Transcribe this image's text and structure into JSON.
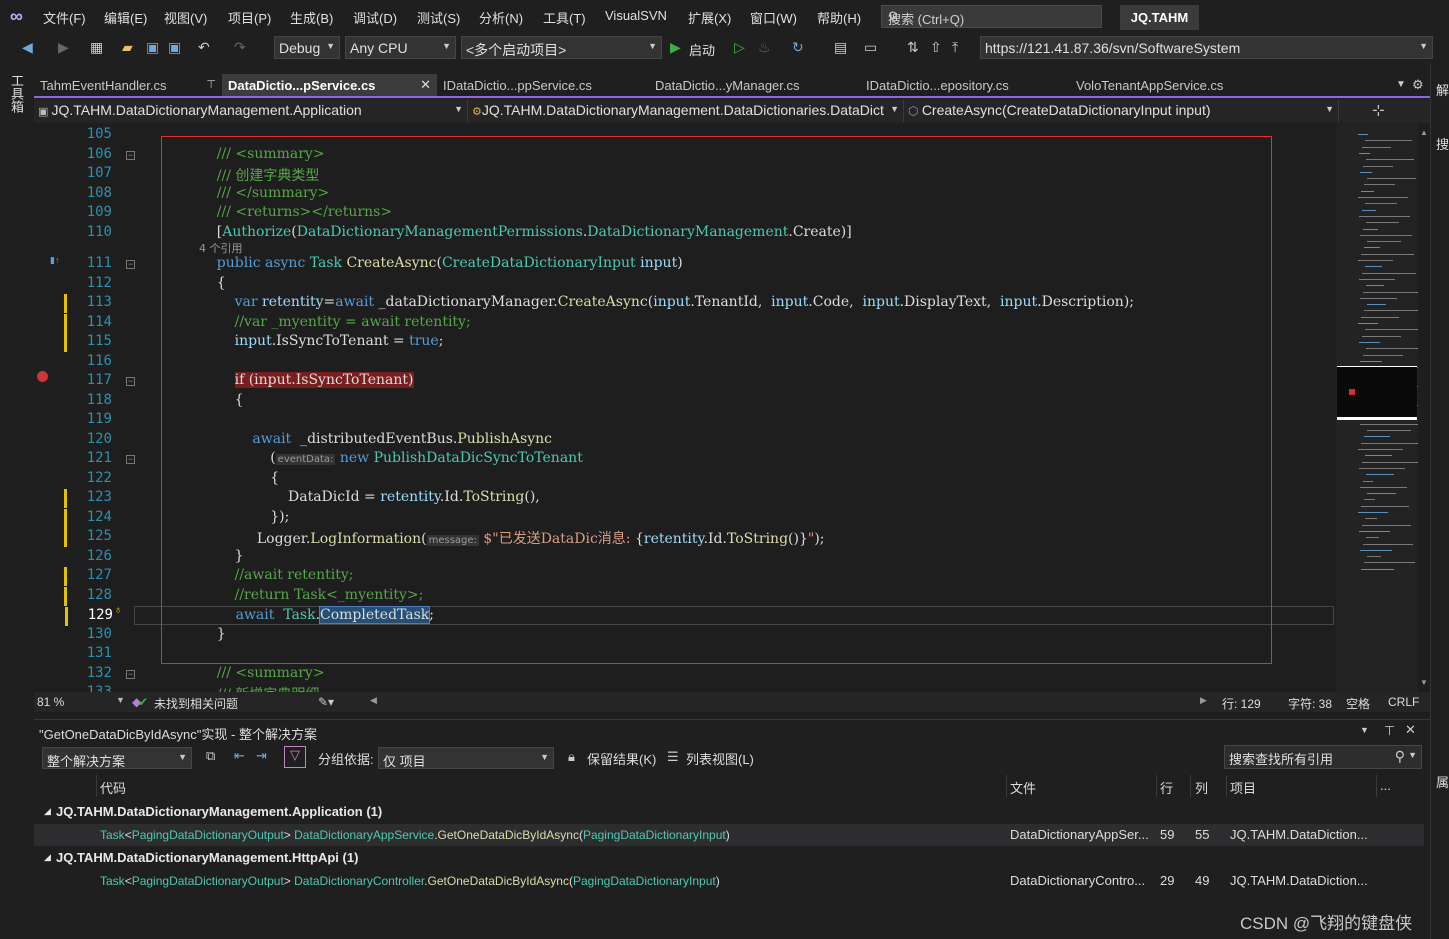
{
  "menu": {
    "items": [
      "文件(F)",
      "编辑(E)",
      "视图(V)",
      "项目(P)",
      "生成(B)",
      "调试(D)",
      "测试(S)",
      "分析(N)",
      "工具(T)",
      "VisualSVN",
      "扩展(X)",
      "窗口(W)",
      "帮助(H)"
    ],
    "search_placeholder": "搜索 (Ctrl+Q)",
    "profile": "JQ.TAHM"
  },
  "toolbar": {
    "config": "Debug",
    "platform": "Any CPU",
    "startup": "<多个启动项目>",
    "start_label": "启动",
    "svn_url": "https://121.41.87.36/svn/SoftwareSystem"
  },
  "left_strip": {
    "toolbox": "工具箱"
  },
  "right_strip": {
    "labels": [
      "解",
      "搜",
      "属"
    ]
  },
  "tabs": [
    {
      "label": "TahmEventHandler.cs",
      "active": false
    },
    {
      "label": "DataDictio...pService.cs",
      "active": true
    },
    {
      "label": "IDataDictio...ppService.cs",
      "active": false
    },
    {
      "label": "DataDictio...yManager.cs",
      "active": false
    },
    {
      "label": "IDataDictio...epository.cs",
      "active": false
    },
    {
      "label": "VoloTenantAppService.cs",
      "active": false
    }
  ],
  "navbar": {
    "project": "JQ.TAHM.DataDictionaryManagement.Application",
    "class": "JQ.TAHM.DataDictionaryManagement.DataDictionaries.DataDict",
    "member": "CreateAsync(CreateDataDictionaryInput input)"
  },
  "code": {
    "lines": [
      {
        "n": "105",
        "segs": []
      },
      {
        "n": "106",
        "segs": [
          {
            "c": "c-com",
            "t": "    /// <summary>"
          }
        ]
      },
      {
        "n": "107",
        "segs": [
          {
            "c": "c-com",
            "t": "    /// 创建字典类型"
          }
        ]
      },
      {
        "n": "108",
        "segs": [
          {
            "c": "c-com",
            "t": "    /// </summary>"
          }
        ]
      },
      {
        "n": "109",
        "segs": [
          {
            "c": "c-com",
            "t": "    /// <returns></returns>"
          }
        ]
      },
      {
        "n": "110",
        "segs": [
          {
            "c": "",
            "t": "    ["
          },
          {
            "c": "c-type",
            "t": "Authorize"
          },
          {
            "c": "",
            "t": "("
          },
          {
            "c": "c-type",
            "t": "DataDictionaryManagementPermissions"
          },
          {
            "c": "",
            "t": "."
          },
          {
            "c": "c-type",
            "t": "DataDictionaryManagement"
          },
          {
            "c": "",
            "t": ".Create)]"
          }
        ]
      },
      {
        "n": "111",
        "segs": [
          {
            "c": "c-kw",
            "t": "    public async "
          },
          {
            "c": "c-type",
            "t": "Task "
          },
          {
            "c": "c-meth",
            "t": "CreateAsync"
          },
          {
            "c": "",
            "t": "("
          },
          {
            "c": "c-type",
            "t": "CreateDataDictionaryInput "
          },
          {
            "c": "c-param",
            "t": "input"
          },
          {
            "c": "",
            "t": ")"
          }
        ]
      },
      {
        "n": "112",
        "segs": [
          {
            "c": "",
            "t": "    {"
          }
        ]
      },
      {
        "n": "113",
        "segs": [
          {
            "c": "c-kw",
            "t": "        var "
          },
          {
            "c": "c-param",
            "t": "retentity"
          },
          {
            "c": "",
            "t": "="
          },
          {
            "c": "c-kw",
            "t": "await "
          },
          {
            "c": "",
            "t": "_dataDictionaryManager."
          },
          {
            "c": "c-meth",
            "t": "CreateAsync"
          },
          {
            "c": "",
            "t": "("
          },
          {
            "c": "c-param",
            "t": "input"
          },
          {
            "c": "",
            "t": ".TenantId,  "
          },
          {
            "c": "c-param",
            "t": "input"
          },
          {
            "c": "",
            "t": ".Code,  "
          },
          {
            "c": "c-param",
            "t": "input"
          },
          {
            "c": "",
            "t": ".DisplayText,  "
          },
          {
            "c": "c-param",
            "t": "input"
          },
          {
            "c": "",
            "t": ".Description);"
          }
        ]
      },
      {
        "n": "114",
        "segs": [
          {
            "c": "c-com",
            "t": "        //var _myentity = await retentity;"
          }
        ]
      },
      {
        "n": "115",
        "segs": [
          {
            "c": "c-param",
            "t": "        input"
          },
          {
            "c": "",
            "t": ".IsSyncToTenant = "
          },
          {
            "c": "c-kw",
            "t": "true"
          },
          {
            "c": "",
            "t": ";"
          }
        ]
      },
      {
        "n": "116",
        "segs": []
      },
      {
        "n": "117",
        "segs": [
          {
            "c": "",
            "t": "        "
          },
          {
            "c": "bp-highlight",
            "t": "if (input.IsSyncToTenant)"
          }
        ]
      },
      {
        "n": "118",
        "segs": [
          {
            "c": "",
            "t": "        {"
          }
        ]
      },
      {
        "n": "119",
        "segs": []
      },
      {
        "n": "120",
        "segs": [
          {
            "c": "c-kw",
            "t": "            await  "
          },
          {
            "c": "",
            "t": "_distributedEventBus."
          },
          {
            "c": "c-meth",
            "t": "PublishAsync"
          }
        ]
      },
      {
        "n": "121",
        "segs": [
          {
            "c": "",
            "t": "                ("
          },
          {
            "c": "c-hint",
            "t": "eventData:"
          },
          {
            "c": "c-kw",
            "t": " new "
          },
          {
            "c": "c-type",
            "t": "PublishDataDicSyncToTenant"
          }
        ]
      },
      {
        "n": "122",
        "segs": [
          {
            "c": "",
            "t": "                {"
          }
        ]
      },
      {
        "n": "123",
        "segs": [
          {
            "c": "",
            "t": "                    DataDicId = "
          },
          {
            "c": "c-param",
            "t": "retentity"
          },
          {
            "c": "",
            "t": ".Id."
          },
          {
            "c": "c-meth",
            "t": "ToString"
          },
          {
            "c": "",
            "t": "(),"
          }
        ]
      },
      {
        "n": "124",
        "segs": [
          {
            "c": "",
            "t": "                });"
          }
        ]
      },
      {
        "n": "125",
        "segs": [
          {
            "c": "",
            "t": "             Logger."
          },
          {
            "c": "c-meth",
            "t": "LogInformation"
          },
          {
            "c": "",
            "t": "("
          },
          {
            "c": "c-hint",
            "t": "message:"
          },
          {
            "c": "c-str",
            "t": " $\"已发送DataDic消息: "
          },
          {
            "c": "",
            "t": "{"
          },
          {
            "c": "c-param",
            "t": "retentity"
          },
          {
            "c": "",
            "t": ".Id."
          },
          {
            "c": "c-meth",
            "t": "ToString"
          },
          {
            "c": "",
            "t": "()}"
          },
          {
            "c": "c-str",
            "t": "\""
          },
          {
            "c": "",
            "t": ");"
          }
        ]
      },
      {
        "n": "126",
        "segs": [
          {
            "c": "",
            "t": "        }"
          }
        ]
      },
      {
        "n": "127",
        "segs": [
          {
            "c": "c-com",
            "t": "        //await retentity;"
          }
        ]
      },
      {
        "n": "128",
        "segs": [
          {
            "c": "c-com",
            "t": "        //return Task<_myentity>;"
          }
        ]
      },
      {
        "n": "129",
        "segs": [
          {
            "c": "c-kw",
            "t": "        await  "
          },
          {
            "c": "c-type",
            "t": "Task"
          },
          {
            "c": "",
            "t": "."
          },
          {
            "c": "sel-word",
            "t": "CompletedTask"
          },
          {
            "c": "",
            "t": ";"
          }
        ]
      },
      {
        "n": "130",
        "segs": [
          {
            "c": "",
            "t": "    }"
          }
        ]
      },
      {
        "n": "131",
        "segs": []
      },
      {
        "n": "132",
        "segs": [
          {
            "c": "c-com",
            "t": "    /// <summary>"
          }
        ]
      },
      {
        "n": "133",
        "segs": [
          {
            "c": "c-com",
            "t": "    /// 新增字典明细"
          }
        ]
      }
    ],
    "ref_count": "4 个引用"
  },
  "editor_status": {
    "zoom": "81 %",
    "issues": "未找到相关问题",
    "line": "行: 129",
    "col": "字符: 38",
    "spaces": "空格",
    "eol": "CRLF"
  },
  "panel": {
    "title": "\"GetOneDataDicByIdAsync\"实现 - 整个解决方案",
    "scope": "整个解决方案",
    "group_by_label": "分组依据:",
    "group_by": "仅 项目",
    "keep_results": "保留结果(K)",
    "list_view": "列表视图(L)",
    "search_placeholder": "搜索查找所有引用",
    "headers": {
      "code": "代码",
      "file": "文件",
      "line": "行",
      "col": "列",
      "project": "项目",
      "more": "..."
    },
    "groups": [
      {
        "name": "JQ.TAHM.DataDictionaryManagement.Application (1)",
        "rows": [
          {
            "sig_type": "Task",
            "sig_ret": "PagingDataDictionaryOutput",
            "sig_class": "DataDictionaryAppService",
            "sig_method": "GetOneDataDicByIdAsync",
            "sig_param": "PagingDataDictionaryInput",
            "file": "DataDictionaryAppSer...",
            "line": "59",
            "col": "55",
            "project": "JQ.TAHM.DataDiction..."
          }
        ]
      },
      {
        "name": "JQ.TAHM.DataDictionaryManagement.HttpApi (1)",
        "rows": [
          {
            "sig_type": "Task",
            "sig_ret": "PagingDataDictionaryOutput",
            "sig_class": "DataDictionaryController",
            "sig_method": "GetOneDataDicByIdAsync",
            "sig_param": "PagingDataDictionaryInput",
            "file": "DataDictionaryContro...",
            "line": "29",
            "col": "49",
            "project": "JQ.TAHM.DataDiction..."
          }
        ]
      }
    ]
  },
  "watermark": "CSDN @飞翔的键盘侠",
  "colors": {
    "accent": "#8c6bd8",
    "breakpoint": "#d13438",
    "selection_box": "#e03030"
  }
}
